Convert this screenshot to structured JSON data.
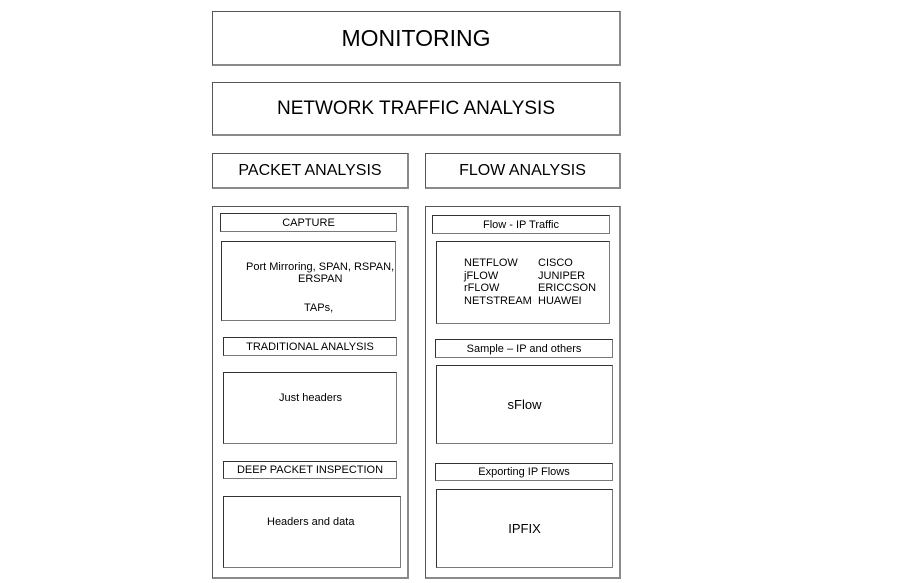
{
  "top": {
    "monitoring": "MONITORING",
    "network_traffic_analysis": "NETWORK TRAFFIC ANALYSIS"
  },
  "packet_analysis": {
    "title": "PACKET ANALYSIS",
    "capture": {
      "header": "CAPTURE",
      "line1": "Port Mirroring, SPAN, RSPAN,",
      "line2": "ERSPAN",
      "line3": "TAPs,"
    },
    "traditional": {
      "header": "TRADITIONAL ANALYSIS",
      "content": "Just headers"
    },
    "dpi": {
      "header": "DEEP PACKET INSPECTION",
      "content": "Headers and data"
    }
  },
  "flow_analysis": {
    "title": "FLOW ANALYSIS",
    "flow_ip": {
      "header": "Flow - IP Traffic",
      "protocols": [
        {
          "protocol": "NETFLOW",
          "vendor": "CISCO"
        },
        {
          "protocol": "jFLOW",
          "vendor": "JUNIPER"
        },
        {
          "protocol": "rFLOW",
          "vendor": "ERICCSON"
        },
        {
          "protocol": "NETSTREAM",
          "vendor": "HUAWEI"
        }
      ]
    },
    "sample": {
      "header": "Sample – IP and others",
      "content": "sFlow"
    },
    "exporting": {
      "header": "Exporting IP Flows",
      "content": "IPFIX"
    }
  }
}
